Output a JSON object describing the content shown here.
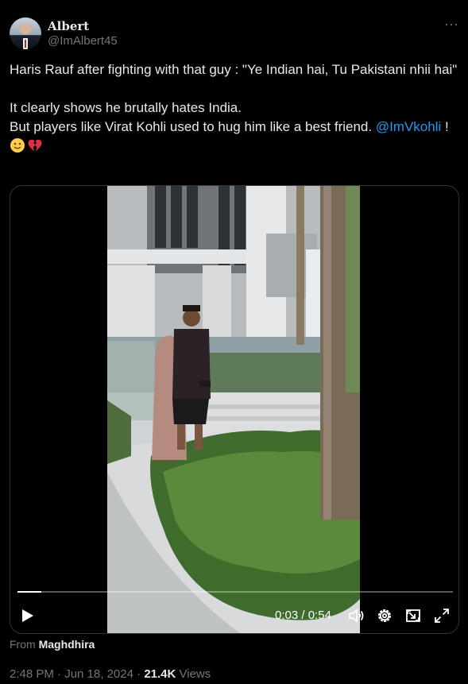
{
  "author": {
    "name": "Albert",
    "handle": "@ImAlbert45"
  },
  "tweet": {
    "line1": "Haris Rauf after fighting with that guy : \"Ye Indian hai, Tu Pakistani nhii hai\"",
    "line2": "It clearly shows he brutally hates India.",
    "line3_before": "But players like Virat Kohli used to hug him like a best friend. ",
    "mention": "@ImVkohli",
    "line3_after": " !",
    "emojis": [
      "slightly-smiling-face-icon",
      "broken-heart-icon"
    ]
  },
  "video": {
    "current_time": "0:03",
    "separator": " / ",
    "duration": "0:54",
    "progress_fraction": 0.055,
    "controls": [
      "play-icon",
      "volume-icon",
      "settings-icon",
      "pop-out-icon",
      "fullscreen-icon"
    ]
  },
  "source": {
    "from_label": "From",
    "account": "Maghdhira"
  },
  "meta": {
    "time": "2:48 PM",
    "dot1": " · ",
    "date": "Jun 18, 2024",
    "dot2": " · ",
    "views_count": "21.4K",
    "views_label": "Views"
  },
  "colors": {
    "background": "#000000",
    "text": "#e7e9ea",
    "secondary": "#71767b",
    "link": "#1d9bf0",
    "border": "#2f3336"
  }
}
